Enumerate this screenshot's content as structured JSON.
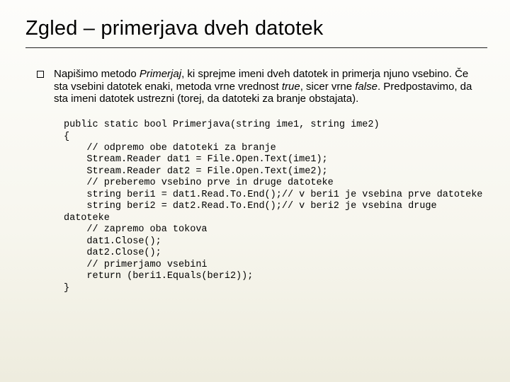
{
  "title": "Zgled – primerjava dveh datotek",
  "paragraph": {
    "t1": "Napišimo metodo ",
    "i1": "Primerjaj",
    "t2": ", ki sprejme imeni dveh datotek in primerja njuno vsebino. Če sta vsebini datotek enaki, metoda vrne vrednost ",
    "i2": "true",
    "t3": ", sicer vrne ",
    "i3": "false",
    "t4": ". Predpostavimo, da sta imeni datotek ustrezni (torej, da datoteki za branje obstajata)."
  },
  "code": "public static bool Primerjava(string ime1, string ime2)\n{\n    // odpremo obe datoteki za branje\n    Stream.Reader dat1 = File.Open.Text(ime1);\n    Stream.Reader dat2 = File.Open.Text(ime2);\n    // preberemo vsebino prve in druge datoteke\n    string beri1 = dat1.Read.To.End();// v beri1 je vsebina prve datoteke\n    string beri2 = dat2.Read.To.End();// v beri2 je vsebina druge datoteke\n    // zapremo oba tokova\n    dat1.Close();\n    dat2.Close();\n    // primerjamo vsebini\n    return (beri1.Equals(beri2));\n}"
}
